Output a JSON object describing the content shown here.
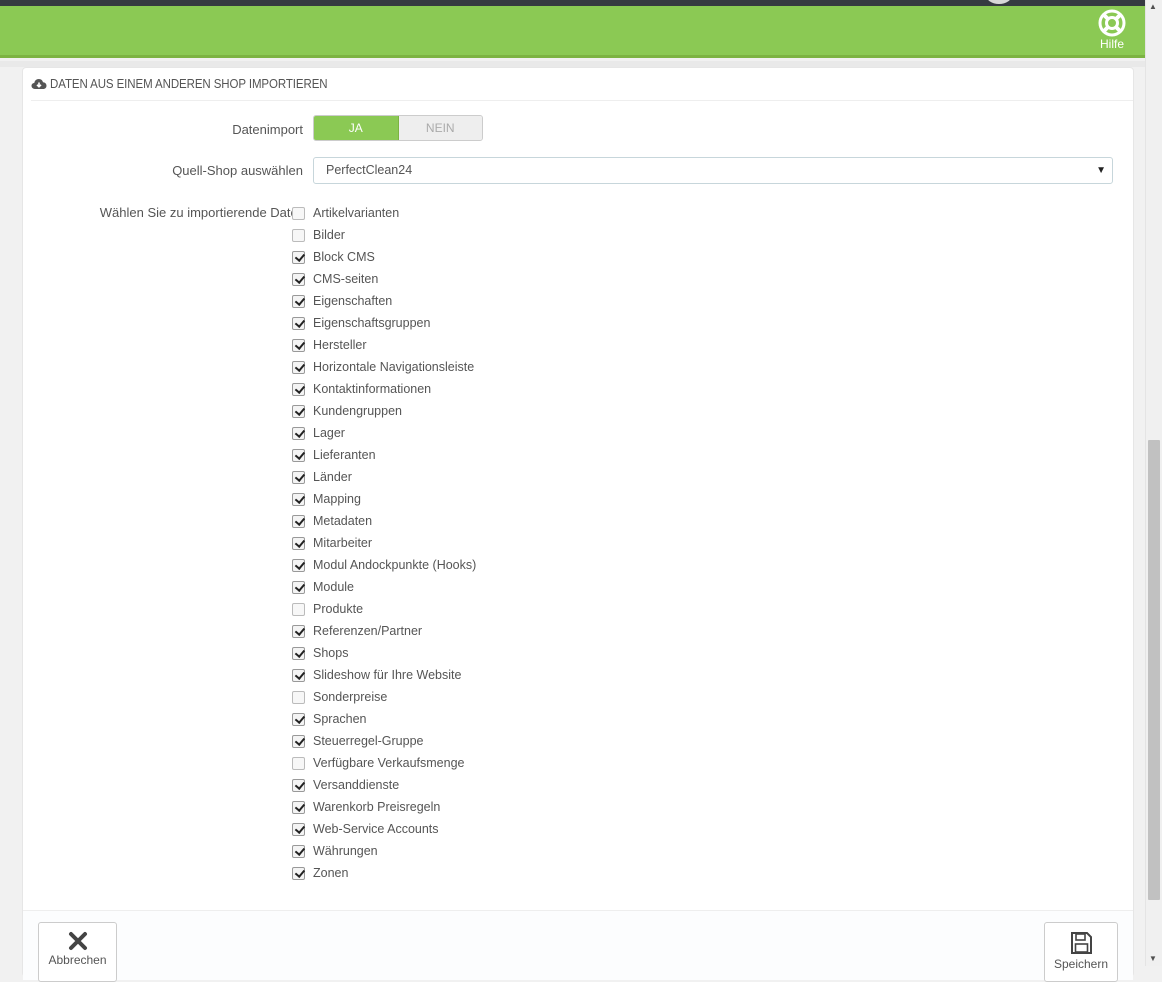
{
  "header": {
    "help_label": "Hilfe",
    "accent_color": "#8bc954"
  },
  "panel": {
    "title": "Daten aus einem anderen Shop importieren",
    "title_icon": "cloud-download-icon"
  },
  "form": {
    "import_label": "Datenimport",
    "import_switch": {
      "yes_label": "JA",
      "no_label": "NEIN",
      "selected": "JA"
    },
    "source_shop_label": "Quell-Shop auswählen",
    "source_shop_value": "PerfectClean24",
    "data_label": "Wählen Sie zu importierende Daten",
    "items": [
      {
        "label": "Artikelvarianten",
        "checked": false
      },
      {
        "label": "Bilder",
        "checked": false
      },
      {
        "label": "Block CMS",
        "checked": true
      },
      {
        "label": "CMS-seiten",
        "checked": true
      },
      {
        "label": "Eigenschaften",
        "checked": true
      },
      {
        "label": "Eigenschaftsgruppen",
        "checked": true
      },
      {
        "label": "Hersteller",
        "checked": true
      },
      {
        "label": "Horizontale Navigationsleiste",
        "checked": true
      },
      {
        "label": "Kontaktinformationen",
        "checked": true
      },
      {
        "label": "Kundengruppen",
        "checked": true
      },
      {
        "label": "Lager",
        "checked": true
      },
      {
        "label": "Lieferanten",
        "checked": true
      },
      {
        "label": "Länder",
        "checked": true
      },
      {
        "label": "Mapping",
        "checked": true
      },
      {
        "label": "Metadaten",
        "checked": true
      },
      {
        "label": "Mitarbeiter",
        "checked": true
      },
      {
        "label": "Modul Andockpunkte (Hooks)",
        "checked": true
      },
      {
        "label": "Module",
        "checked": true
      },
      {
        "label": "Produkte",
        "checked": false
      },
      {
        "label": "Referenzen/Partner",
        "checked": true
      },
      {
        "label": "Shops",
        "checked": true
      },
      {
        "label": "Slideshow für Ihre Website",
        "checked": true
      },
      {
        "label": "Sonderpreise",
        "checked": false
      },
      {
        "label": "Sprachen",
        "checked": true
      },
      {
        "label": "Steuerregel-Gruppe",
        "checked": true
      },
      {
        "label": "Verfügbare Verkaufsmenge",
        "checked": false
      },
      {
        "label": "Versanddienste",
        "checked": true
      },
      {
        "label": "Warenkorb Preisregeln",
        "checked": true
      },
      {
        "label": "Web-Service Accounts",
        "checked": true
      },
      {
        "label": "Währungen",
        "checked": true
      },
      {
        "label": "Zonen",
        "checked": true
      }
    ]
  },
  "footer": {
    "cancel_label": "Abbrechen",
    "cancel_icon": "close-icon",
    "save_label": "Speichern",
    "save_icon": "floppy-disk-icon"
  }
}
